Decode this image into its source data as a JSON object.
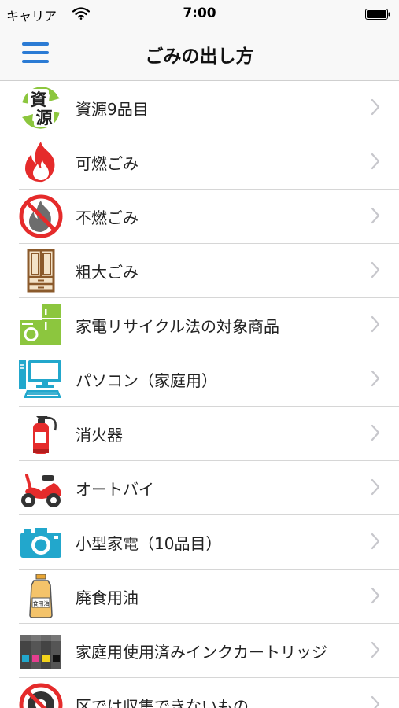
{
  "status_bar": {
    "carrier": "キャリア",
    "time": "7:00"
  },
  "nav": {
    "title": "ごみの出し方"
  },
  "items": [
    {
      "label": "資源9品目",
      "icon": "resource-recycle-icon"
    },
    {
      "label": "可燃ごみ",
      "icon": "burnable-flame-icon"
    },
    {
      "label": "不燃ごみ",
      "icon": "non-burnable-icon"
    },
    {
      "label": "粗大ごみ",
      "icon": "cabinet-icon"
    },
    {
      "label": "家電リサイクル法の対象商品",
      "icon": "appliance-icon"
    },
    {
      "label": "パソコン（家庭用）",
      "icon": "computer-icon"
    },
    {
      "label": "消火器",
      "icon": "fire-extinguisher-icon"
    },
    {
      "label": "オートバイ",
      "icon": "motorcycle-icon"
    },
    {
      "label": "小型家電（10品目）",
      "icon": "camera-icon"
    },
    {
      "label": "廃食用油",
      "icon": "cooking-oil-icon"
    },
    {
      "label": "家庭用使用済みインクカートリッジ",
      "icon": "ink-cartridge-icon"
    },
    {
      "label": "区では収集できないもの",
      "icon": "tire-icon"
    }
  ],
  "resource_icon_text": [
    "資",
    "源"
  ],
  "oil_label_text": "食用油",
  "colors": {
    "accent": "#2b7bd4",
    "flame": "#e52b2b",
    "green": "#8cc63e",
    "cyan": "#22a7cc",
    "brown": "#8b5a2b"
  }
}
